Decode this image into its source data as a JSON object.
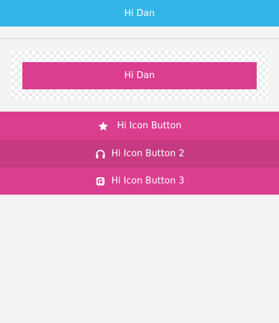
{
  "header": {
    "title": "Hi Dan"
  },
  "hero_button": {
    "label": "Hi Dan"
  },
  "icon_buttons": [
    {
      "label": "Hi Icon Button",
      "icon": "star-icon"
    },
    {
      "label": "Hi Icon Button 2",
      "icon": "headphones-icon"
    },
    {
      "label": "Hi Icon Button 3",
      "icon": "app-square-icon"
    }
  ],
  "colors": {
    "header": "#34b5e8",
    "pink": "#db3d8f",
    "pink_dark": "#c53a80",
    "background": "#f3f3f3"
  }
}
